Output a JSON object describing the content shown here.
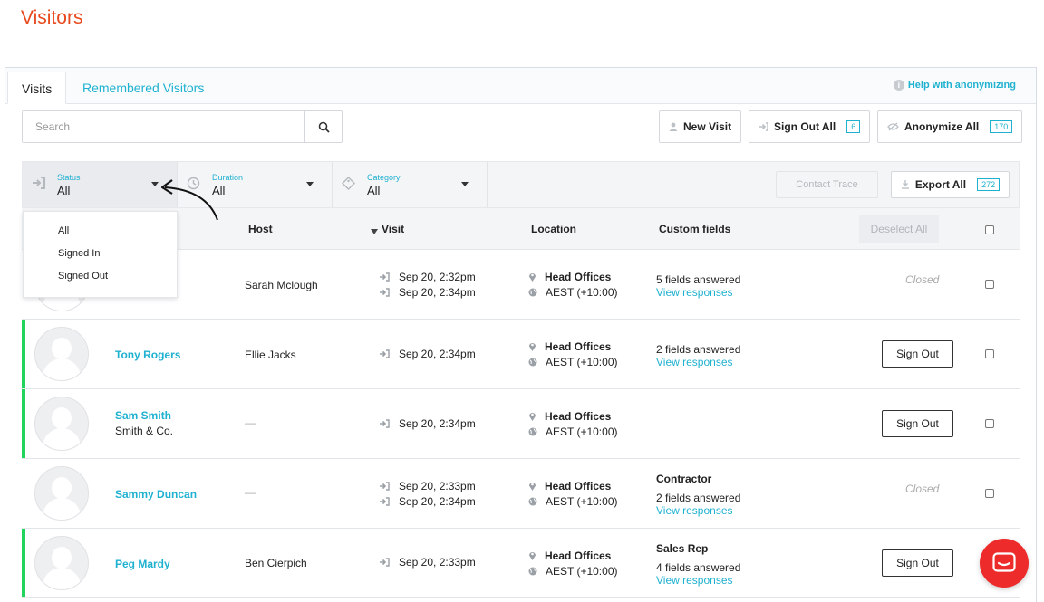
{
  "page": {
    "title": "Visitors"
  },
  "tabs": [
    {
      "label": "Visits",
      "active": true
    },
    {
      "label": "Remembered Visitors",
      "active": false
    }
  ],
  "help": {
    "label": "Help with anonymizing"
  },
  "search": {
    "placeholder": "Search",
    "value": ""
  },
  "toolbar": {
    "new_visit": "New Visit",
    "sign_out_all": "Sign Out All",
    "sign_out_all_count": "6",
    "anonymize_all": "Anonymize All",
    "anonymize_all_count": "170"
  },
  "filters": {
    "status": {
      "label": "Status",
      "value": "All"
    },
    "duration": {
      "label": "Duration",
      "value": "All"
    },
    "category": {
      "label": "Category",
      "value": "All"
    },
    "contact_trace": "Contact Trace",
    "export_all": "Export All",
    "export_all_count": "272"
  },
  "status_dropdown": {
    "options": [
      "All",
      "Signed In",
      "Signed Out"
    ]
  },
  "table": {
    "headers": {
      "host": "Host",
      "visit": "Visit",
      "location": "Location",
      "custom_fields": "Custom fields",
      "deselect_all": "Deselect All"
    },
    "sign_out_label": "Sign Out",
    "view_responses_label": "View responses",
    "rows": [
      {
        "name": "",
        "company": "",
        "host": "Sarah Mclough",
        "visit_in": "Sep 20, 2:32pm",
        "visit_out": "Sep 20, 2:34pm",
        "location": "Head Offices",
        "timezone": "AEST (+10:00)",
        "category": "",
        "fields": "5 fields answered",
        "status": "Closed"
      },
      {
        "name": "Tony Rogers",
        "company": "",
        "host": "Ellie Jacks",
        "visit_in": "Sep 20, 2:34pm",
        "visit_out": "",
        "location": "Head Offices",
        "timezone": "AEST (+10:00)",
        "category": "",
        "fields": "2 fields answered",
        "status": "Sign Out"
      },
      {
        "name": "Sam Smith",
        "company": "Smith & Co.",
        "host": "—",
        "visit_in": "Sep 20, 2:34pm",
        "visit_out": "",
        "location": "Head Offices",
        "timezone": "AEST (+10:00)",
        "category": "",
        "fields": "",
        "status": "Sign Out"
      },
      {
        "name": "Sammy Duncan",
        "company": "",
        "host": "—",
        "visit_in": "Sep 20, 2:33pm",
        "visit_out": "Sep 20, 2:34pm",
        "location": "Head Offices",
        "timezone": "AEST (+10:00)",
        "category": "Contractor",
        "fields": "2 fields answered",
        "status": "Closed"
      },
      {
        "name": "Peg Mardy",
        "company": "",
        "host": "Ben Cierpich",
        "visit_in": "Sep 20, 2:33pm",
        "visit_out": "",
        "location": "Head Offices",
        "timezone": "AEST (+10:00)",
        "category": "Sales Rep",
        "fields": "4 fields answered",
        "status": "Sign Out"
      }
    ]
  },
  "colors": {
    "accent": "#1fb1d0",
    "title": "#e8491d",
    "active_bar": "#22d45b",
    "chat": "#ee2b2b"
  }
}
